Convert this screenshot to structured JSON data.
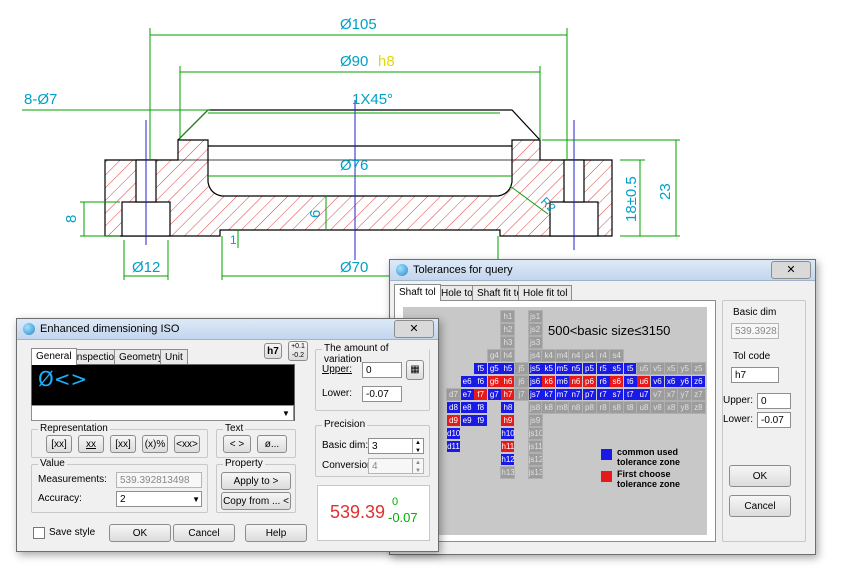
{
  "drawing": {
    "dims": {
      "d105": "Ø105",
      "d90": "Ø90",
      "d90_tol": "h8",
      "holes": "8-Ø7",
      "chamfer": "1X45°",
      "d76": "Ø76",
      "d70": "Ø70",
      "d12": "Ø12",
      "h8": "8",
      "h6": "6",
      "h1": "1",
      "r2": "R2",
      "h18": "18±0.5",
      "h23": "23"
    },
    "colors": {
      "line": "#00a000",
      "hatch": "#e04040",
      "center": "#2020d0",
      "text": "#00a0c8",
      "tol": "#e6e600"
    }
  },
  "dim_dialog": {
    "title": "Enhanced dimensioning ISO",
    "tabs": [
      "General",
      "Inspection",
      "Geometry",
      "Unit"
    ],
    "badge_fit": "h7",
    "badge_tol_upper": "+0.1",
    "badge_tol_lower": "-0.2",
    "editor_text": "Ø<>",
    "representation": {
      "label": "Representation",
      "buttons": [
        "[xx]",
        "xx",
        "[xx]",
        "(x)%",
        "<xx>"
      ]
    },
    "text_group": {
      "label": "Text",
      "buttons": [
        "< >",
        "ø..."
      ]
    },
    "value_group": {
      "label": "Value",
      "measurements_label": "Measurements:",
      "measurements_value": "539.392813498",
      "accuracy_label": "Accuracy:",
      "accuracy_value": "2"
    },
    "property_group": {
      "label": "Property",
      "apply": "Apply to >",
      "copy": "Copy from ... <"
    },
    "variation": {
      "label": "The amount of variation",
      "upper_label": "Upper:",
      "upper_value": "0",
      "lower_label": "Lower:",
      "lower_value": "-0.07"
    },
    "precision": {
      "label": "Precision",
      "basic_label": "Basic dim:",
      "basic_value": "3",
      "conv_label": "Conversion:",
      "conv_value": "4"
    },
    "preview": {
      "main": "539.39",
      "upper": "0",
      "lower": "-0.07"
    },
    "save_style": "Save style",
    "ok": "OK",
    "cancel": "Cancel",
    "help": "Help"
  },
  "tol_dialog": {
    "title": "Tolerances for query",
    "tabs": [
      "Shaft tol",
      "Hole tol",
      "Shaft fit tol",
      "Hole fit tol"
    ],
    "range_title": "500<basic size≤3150",
    "legend_blue": "common  used tolerance zone",
    "legend_red": "First choose tolerance zone",
    "basic_dim_label": "Basic dim",
    "basic_dim_value": "539.392813",
    "tol_code_label": "Tol code",
    "tol_code_value": "h7",
    "upper_label": "Upper:",
    "upper_value": "0",
    "lower_label": "Lower:",
    "lower_value": "-0.07",
    "ok": "OK",
    "cancel": "Cancel",
    "colors": {
      "blue": "#1a1ae6",
      "red": "#e61a1a",
      "grey": "#9c9c9c"
    },
    "grid": [
      {
        "r": 0,
        "c": 4,
        "t": "h1",
        "k": "g"
      },
      {
        "r": 0,
        "c": 6,
        "t": "js1",
        "k": "g"
      },
      {
        "r": 1,
        "c": 4,
        "t": "h2",
        "k": "g"
      },
      {
        "r": 1,
        "c": 6,
        "t": "js2",
        "k": "g"
      },
      {
        "r": 2,
        "c": 4,
        "t": "h3",
        "k": "g"
      },
      {
        "r": 2,
        "c": 6,
        "t": "js3",
        "k": "g"
      },
      {
        "r": 3,
        "c": 3,
        "t": "g4",
        "k": "g"
      },
      {
        "r": 3,
        "c": 4,
        "t": "h4",
        "k": "g"
      },
      {
        "r": 3,
        "c": 6,
        "t": "js4",
        "k": "g"
      },
      {
        "r": 3,
        "c": 7,
        "t": "k4",
        "k": "g"
      },
      {
        "r": 3,
        "c": 8,
        "t": "m4",
        "k": "g"
      },
      {
        "r": 3,
        "c": 9,
        "t": "n4",
        "k": "g"
      },
      {
        "r": 3,
        "c": 10,
        "t": "p4",
        "k": "g"
      },
      {
        "r": 3,
        "c": 11,
        "t": "r4",
        "k": "g"
      },
      {
        "r": 3,
        "c": 12,
        "t": "s4",
        "k": "g"
      },
      {
        "r": 4,
        "c": 2,
        "t": "f5",
        "k": "b"
      },
      {
        "r": 4,
        "c": 3,
        "t": "g5",
        "k": "b"
      },
      {
        "r": 4,
        "c": 4,
        "t": "h5",
        "k": "b"
      },
      {
        "r": 4,
        "c": 5,
        "t": "j5",
        "k": "g"
      },
      {
        "r": 4,
        "c": 6,
        "t": "js5",
        "k": "b"
      },
      {
        "r": 4,
        "c": 7,
        "t": "k5",
        "k": "b"
      },
      {
        "r": 4,
        "c": 8,
        "t": "m5",
        "k": "b"
      },
      {
        "r": 4,
        "c": 9,
        "t": "n5",
        "k": "b"
      },
      {
        "r": 4,
        "c": 10,
        "t": "p5",
        "k": "b"
      },
      {
        "r": 4,
        "c": 11,
        "t": "r5",
        "k": "b"
      },
      {
        "r": 4,
        "c": 12,
        "t": "s5",
        "k": "b"
      },
      {
        "r": 4,
        "c": 13,
        "t": "t5",
        "k": "b"
      },
      {
        "r": 4,
        "c": 14,
        "t": "u5",
        "k": "g"
      },
      {
        "r": 4,
        "c": 15,
        "t": "v5",
        "k": "g"
      },
      {
        "r": 4,
        "c": 16,
        "t": "x5",
        "k": "g"
      },
      {
        "r": 4,
        "c": 17,
        "t": "y5",
        "k": "g"
      },
      {
        "r": 4,
        "c": 18,
        "t": "z5",
        "k": "g"
      },
      {
        "r": 5,
        "c": 1,
        "t": "e6",
        "k": "b"
      },
      {
        "r": 5,
        "c": 2,
        "t": "f6",
        "k": "b"
      },
      {
        "r": 5,
        "c": 3,
        "t": "g6",
        "k": "r"
      },
      {
        "r": 5,
        "c": 4,
        "t": "h6",
        "k": "r"
      },
      {
        "r": 5,
        "c": 5,
        "t": "j6",
        "k": "g"
      },
      {
        "r": 5,
        "c": 6,
        "t": "js6",
        "k": "b"
      },
      {
        "r": 5,
        "c": 7,
        "t": "k6",
        "k": "r"
      },
      {
        "r": 5,
        "c": 8,
        "t": "m6",
        "k": "b"
      },
      {
        "r": 5,
        "c": 9,
        "t": "n6",
        "k": "r"
      },
      {
        "r": 5,
        "c": 10,
        "t": "p6",
        "k": "r"
      },
      {
        "r": 5,
        "c": 11,
        "t": "r6",
        "k": "b"
      },
      {
        "r": 5,
        "c": 12,
        "t": "s6",
        "k": "r"
      },
      {
        "r": 5,
        "c": 13,
        "t": "t6",
        "k": "b"
      },
      {
        "r": 5,
        "c": 14,
        "t": "u6",
        "k": "r"
      },
      {
        "r": 5,
        "c": 15,
        "t": "v6",
        "k": "b"
      },
      {
        "r": 5,
        "c": 16,
        "t": "x6",
        "k": "b"
      },
      {
        "r": 5,
        "c": 17,
        "t": "y6",
        "k": "b"
      },
      {
        "r": 5,
        "c": 18,
        "t": "z6",
        "k": "b"
      },
      {
        "r": 6,
        "c": 0,
        "t": "d7",
        "k": "g"
      },
      {
        "r": 6,
        "c": 1,
        "t": "e7",
        "k": "b"
      },
      {
        "r": 6,
        "c": 2,
        "t": "f7",
        "k": "r"
      },
      {
        "r": 6,
        "c": 3,
        "t": "g7",
        "k": "b"
      },
      {
        "r": 6,
        "c": 4,
        "t": "h7",
        "k": "r"
      },
      {
        "r": 6,
        "c": 5,
        "t": "j7",
        "k": "g"
      },
      {
        "r": 6,
        "c": 6,
        "t": "js7",
        "k": "b"
      },
      {
        "r": 6,
        "c": 7,
        "t": "k7",
        "k": "b"
      },
      {
        "r": 6,
        "c": 8,
        "t": "m7",
        "k": "b"
      },
      {
        "r": 6,
        "c": 9,
        "t": "n7",
        "k": "b"
      },
      {
        "r": 6,
        "c": 10,
        "t": "p7",
        "k": "b"
      },
      {
        "r": 6,
        "c": 11,
        "t": "r7",
        "k": "b"
      },
      {
        "r": 6,
        "c": 12,
        "t": "s7",
        "k": "b"
      },
      {
        "r": 6,
        "c": 13,
        "t": "t7",
        "k": "b"
      },
      {
        "r": 6,
        "c": 14,
        "t": "u7",
        "k": "b"
      },
      {
        "r": 6,
        "c": 15,
        "t": "v7",
        "k": "g"
      },
      {
        "r": 6,
        "c": 16,
        "t": "x7",
        "k": "g"
      },
      {
        "r": 6,
        "c": 17,
        "t": "y7",
        "k": "g"
      },
      {
        "r": 6,
        "c": 18,
        "t": "z7",
        "k": "g"
      },
      {
        "r": 7,
        "c": 0,
        "t": "d8",
        "k": "b"
      },
      {
        "r": 7,
        "c": 1,
        "t": "e8",
        "k": "b"
      },
      {
        "r": 7,
        "c": 2,
        "t": "f8",
        "k": "b"
      },
      {
        "r": 7,
        "c": 4,
        "t": "h8",
        "k": "b"
      },
      {
        "r": 7,
        "c": 6,
        "t": "js8",
        "k": "g"
      },
      {
        "r": 7,
        "c": 7,
        "t": "k8",
        "k": "g"
      },
      {
        "r": 7,
        "c": 8,
        "t": "m8",
        "k": "g"
      },
      {
        "r": 7,
        "c": 9,
        "t": "n8",
        "k": "g"
      },
      {
        "r": 7,
        "c": 10,
        "t": "p8",
        "k": "g"
      },
      {
        "r": 7,
        "c": 11,
        "t": "r8",
        "k": "g"
      },
      {
        "r": 7,
        "c": 12,
        "t": "s8",
        "k": "g"
      },
      {
        "r": 7,
        "c": 13,
        "t": "t8",
        "k": "g"
      },
      {
        "r": 7,
        "c": 14,
        "t": "u8",
        "k": "g"
      },
      {
        "r": 7,
        "c": 15,
        "t": "v8",
        "k": "g"
      },
      {
        "r": 7,
        "c": 16,
        "t": "x8",
        "k": "g"
      },
      {
        "r": 7,
        "c": 17,
        "t": "y8",
        "k": "g"
      },
      {
        "r": 7,
        "c": 18,
        "t": "z8",
        "k": "g"
      },
      {
        "r": 8,
        "c": 0,
        "t": "d9",
        "k": "r"
      },
      {
        "r": 8,
        "c": 1,
        "t": "e9",
        "k": "b"
      },
      {
        "r": 8,
        "c": 2,
        "t": "f9",
        "k": "b"
      },
      {
        "r": 8,
        "c": 4,
        "t": "h9",
        "k": "r"
      },
      {
        "r": 8,
        "c": 6,
        "t": "js9",
        "k": "g"
      },
      {
        "r": 9,
        "c": 0,
        "t": "d10",
        "k": "b"
      },
      {
        "r": 9,
        "c": 4,
        "t": "h10",
        "k": "b"
      },
      {
        "r": 9,
        "c": 6,
        "t": "js10",
        "k": "g"
      },
      {
        "r": 10,
        "c": 0,
        "t": "d11",
        "k": "b"
      },
      {
        "r": 10,
        "c": 4,
        "t": "h11",
        "k": "r"
      },
      {
        "r": 10,
        "c": 6,
        "t": "js11",
        "k": "g"
      },
      {
        "r": 11,
        "c": 4,
        "t": "h12",
        "k": "b"
      },
      {
        "r": 11,
        "c": 6,
        "t": "js12",
        "k": "g"
      },
      {
        "r": 12,
        "c": 4,
        "t": "h13",
        "k": "g"
      },
      {
        "r": 12,
        "c": 6,
        "t": "js13",
        "k": "g"
      }
    ]
  }
}
